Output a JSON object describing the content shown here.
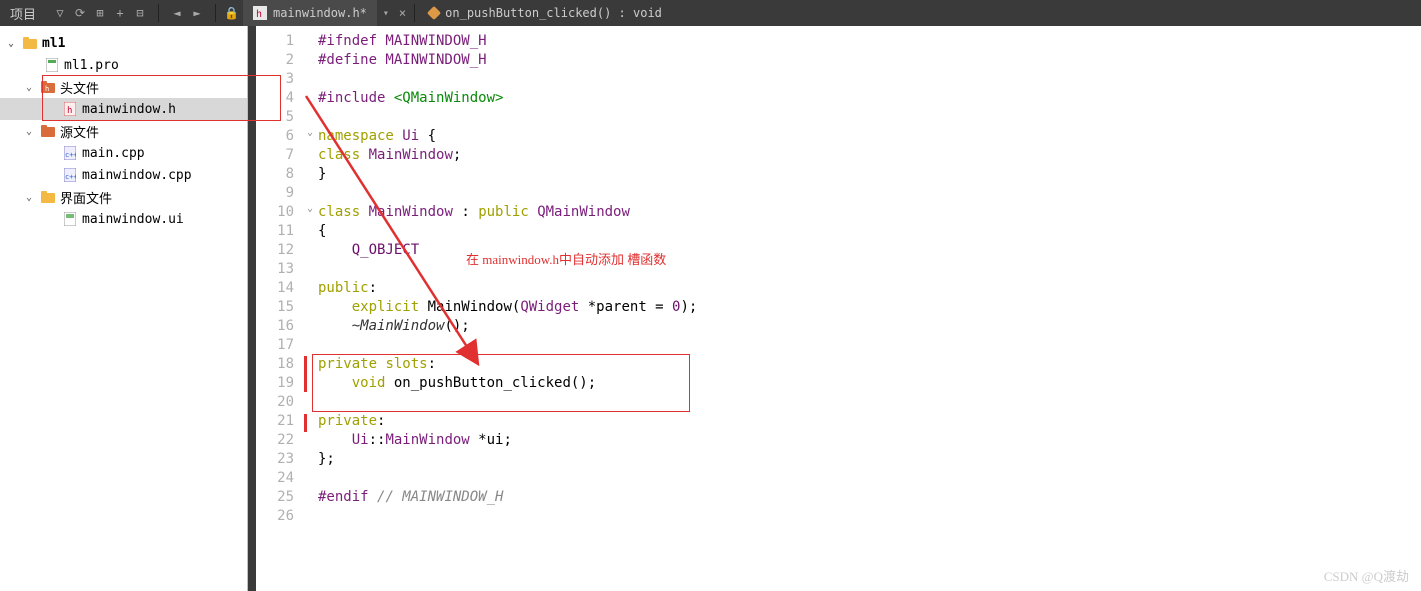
{
  "topbar": {
    "panel_title": "项目",
    "nav_back": "◄",
    "nav_fwd": "►",
    "lock": "🔒",
    "tab_file": "mainwindow.h*",
    "tab_close": "×",
    "breadcrumb_fn": "on_pushButton_clicked() : void"
  },
  "tree": {
    "root": "ml1",
    "pro": "ml1.pro",
    "headers": "头文件",
    "header_file": "mainwindow.h",
    "sources": "源文件",
    "src1": "main.cpp",
    "src2": "mainwindow.cpp",
    "forms": "界面文件",
    "form1": "mainwindow.ui"
  },
  "annotation": "在 mainwindow.h中自动添加 槽函数",
  "watermark": "CSDN @Q渡劫",
  "code": {
    "lines": [
      {
        "n": 1,
        "t": "#ifndef MAINWINDOW_H",
        "cls": "pp"
      },
      {
        "n": 2,
        "t": "#define MAINWINDOW_H",
        "cls": "pp"
      },
      {
        "n": 3,
        "t": "",
        "cls": ""
      },
      {
        "n": 4,
        "html": "<span class='pp'>#include</span> <span class='inc'>&lt;QMainWindow&gt;</span>"
      },
      {
        "n": 5,
        "t": "",
        "cls": ""
      },
      {
        "n": 6,
        "fold": "v",
        "html": "<span class='kw'>namespace</span> <span class='ty'>Ui</span> {"
      },
      {
        "n": 7,
        "html": "<span class='kw'>class</span> <span class='ty'>MainWindow</span>;"
      },
      {
        "n": 8,
        "t": "}",
        "cls": ""
      },
      {
        "n": 9,
        "t": "",
        "cls": ""
      },
      {
        "n": 10,
        "fold": "v",
        "html": "<span class='kw'>class</span> <span class='ty'>MainWindow</span> : <span class='kw'>public</span> <span class='ty'>QMainWindow</span>"
      },
      {
        "n": 11,
        "t": "{",
        "cls": ""
      },
      {
        "n": 12,
        "html": "    <span class='mac'>Q_OBJECT</span>"
      },
      {
        "n": 13,
        "t": "",
        "cls": ""
      },
      {
        "n": 14,
        "html": "<span class='kw'>public</span>:"
      },
      {
        "n": 15,
        "html": "    <span class='kw'>explicit</span> MainWindow(<span class='ty'>QWidget</span> *parent = <span class='mac'>0</span>);"
      },
      {
        "n": 16,
        "html": "    <span class='it'>~MainWindow</span>();"
      },
      {
        "n": 17,
        "t": "",
        "cls": ""
      },
      {
        "n": 18,
        "html": "<span class='kw'>private</span> <span class='kw'>slots</span>:"
      },
      {
        "n": 19,
        "html": "    <span class='kw'>void</span> on_pushButton_clicked();"
      },
      {
        "n": 20,
        "t": "",
        "cls": ""
      },
      {
        "n": 21,
        "html": "<span class='kw'>private</span>:"
      },
      {
        "n": 22,
        "html": "    <span class='ty'>Ui</span>::<span class='ty'>MainWindow</span> *ui;"
      },
      {
        "n": 23,
        "t": "};",
        "cls": ""
      },
      {
        "n": 24,
        "t": "",
        "cls": ""
      },
      {
        "n": 25,
        "html": "<span class='pp'>#endif</span> <span class='cm'>// MAINWINDOW_H</span>"
      },
      {
        "n": 26,
        "t": "",
        "cls": ""
      }
    ]
  }
}
